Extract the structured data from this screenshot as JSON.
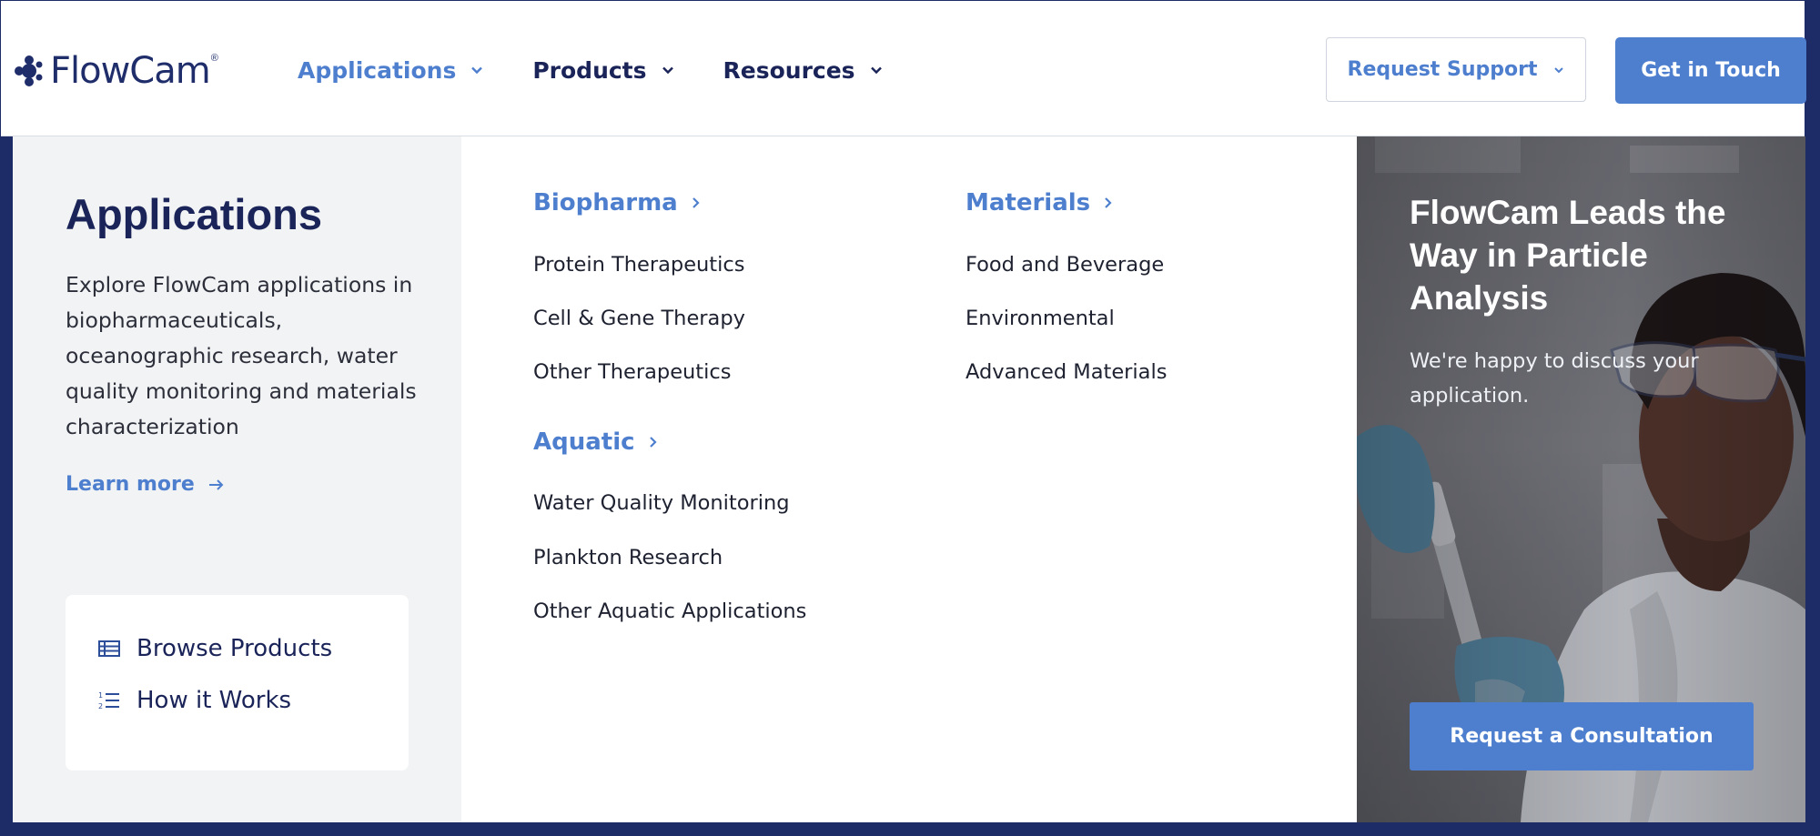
{
  "header": {
    "logo_text": "FlowCam",
    "logo_reg": "®",
    "nav": [
      {
        "label": "Applications",
        "active": true
      },
      {
        "label": "Products",
        "active": false
      },
      {
        "label": "Resources",
        "active": false
      }
    ],
    "support_label": "Request Support",
    "contact_label": "Get in Touch"
  },
  "intro": {
    "title": "Applications",
    "description": "Explore FlowCam applications in biopharmaceuticals, oceanographic research, water quality monitoring and materials characterization",
    "learn_more": "Learn more",
    "quick_links": [
      {
        "label": "Browse Products",
        "icon": "table-list-icon"
      },
      {
        "label": "How it Works",
        "icon": "numbered-list-icon"
      }
    ]
  },
  "menu": {
    "biopharma": {
      "title": "Biopharma",
      "items": [
        "Protein Therapeutics",
        "Cell & Gene Therapy",
        "Other Therapeutics"
      ]
    },
    "aquatic": {
      "title": "Aquatic",
      "items": [
        "Water Quality Monitoring",
        "Plankton Research",
        "Other Aquatic Applications"
      ]
    },
    "materials": {
      "title": "Materials",
      "items": [
        "Food and Beverage",
        "Environmental",
        "Advanced Materials"
      ]
    }
  },
  "promo": {
    "title": "FlowCam Leads the Way in Particle Analysis",
    "text": "We're happy to discuss your application.",
    "button": "Request a Consultation"
  },
  "colors": {
    "brand_navy": "#1a2458",
    "accent_blue": "#4e7fce",
    "page_background": "#1d2b66",
    "panel_gray": "#f2f3f5"
  }
}
